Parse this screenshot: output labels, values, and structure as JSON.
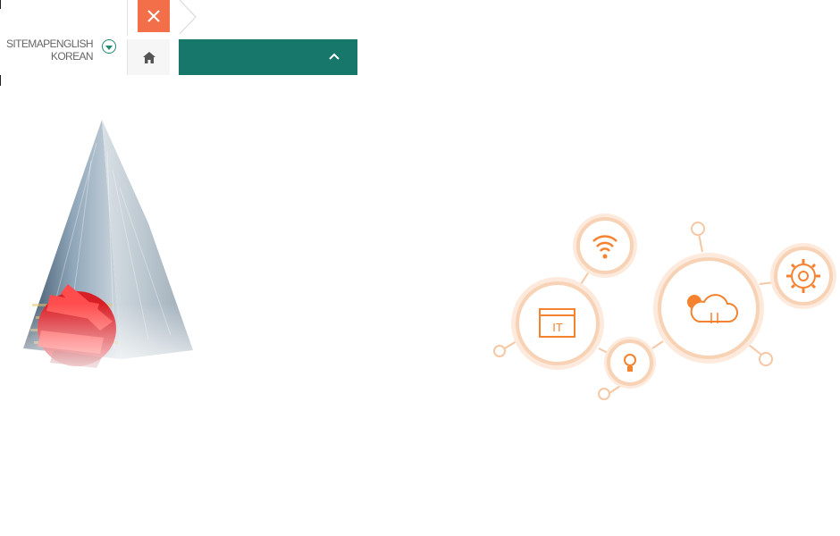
{
  "header": {
    "links": [
      {
        "label": "SITEMAP"
      },
      {
        "label": "ENGLISH"
      },
      {
        "label": "KOREAN"
      }
    ],
    "close_icon": "close-icon",
    "home_icon": "home-icon"
  },
  "menu": {
    "current_label": "",
    "toggle_icon": "chevron-up-icon"
  },
  "graphics": {
    "building_image": "office-building-with-red-sculpture",
    "it_diagram": {
      "center_label": "IT",
      "icons": [
        "wifi-icon",
        "lightbulb-icon",
        "cloud-sync-icon",
        "gear-icon",
        "it-window-icon"
      ]
    }
  },
  "colors": {
    "accent_orange": "#f36f4a",
    "menu_green": "#17776a",
    "toggle_green": "#1f8a72",
    "diagram_orange": "#f29a55",
    "diagram_ring": "#f9d9c2"
  }
}
